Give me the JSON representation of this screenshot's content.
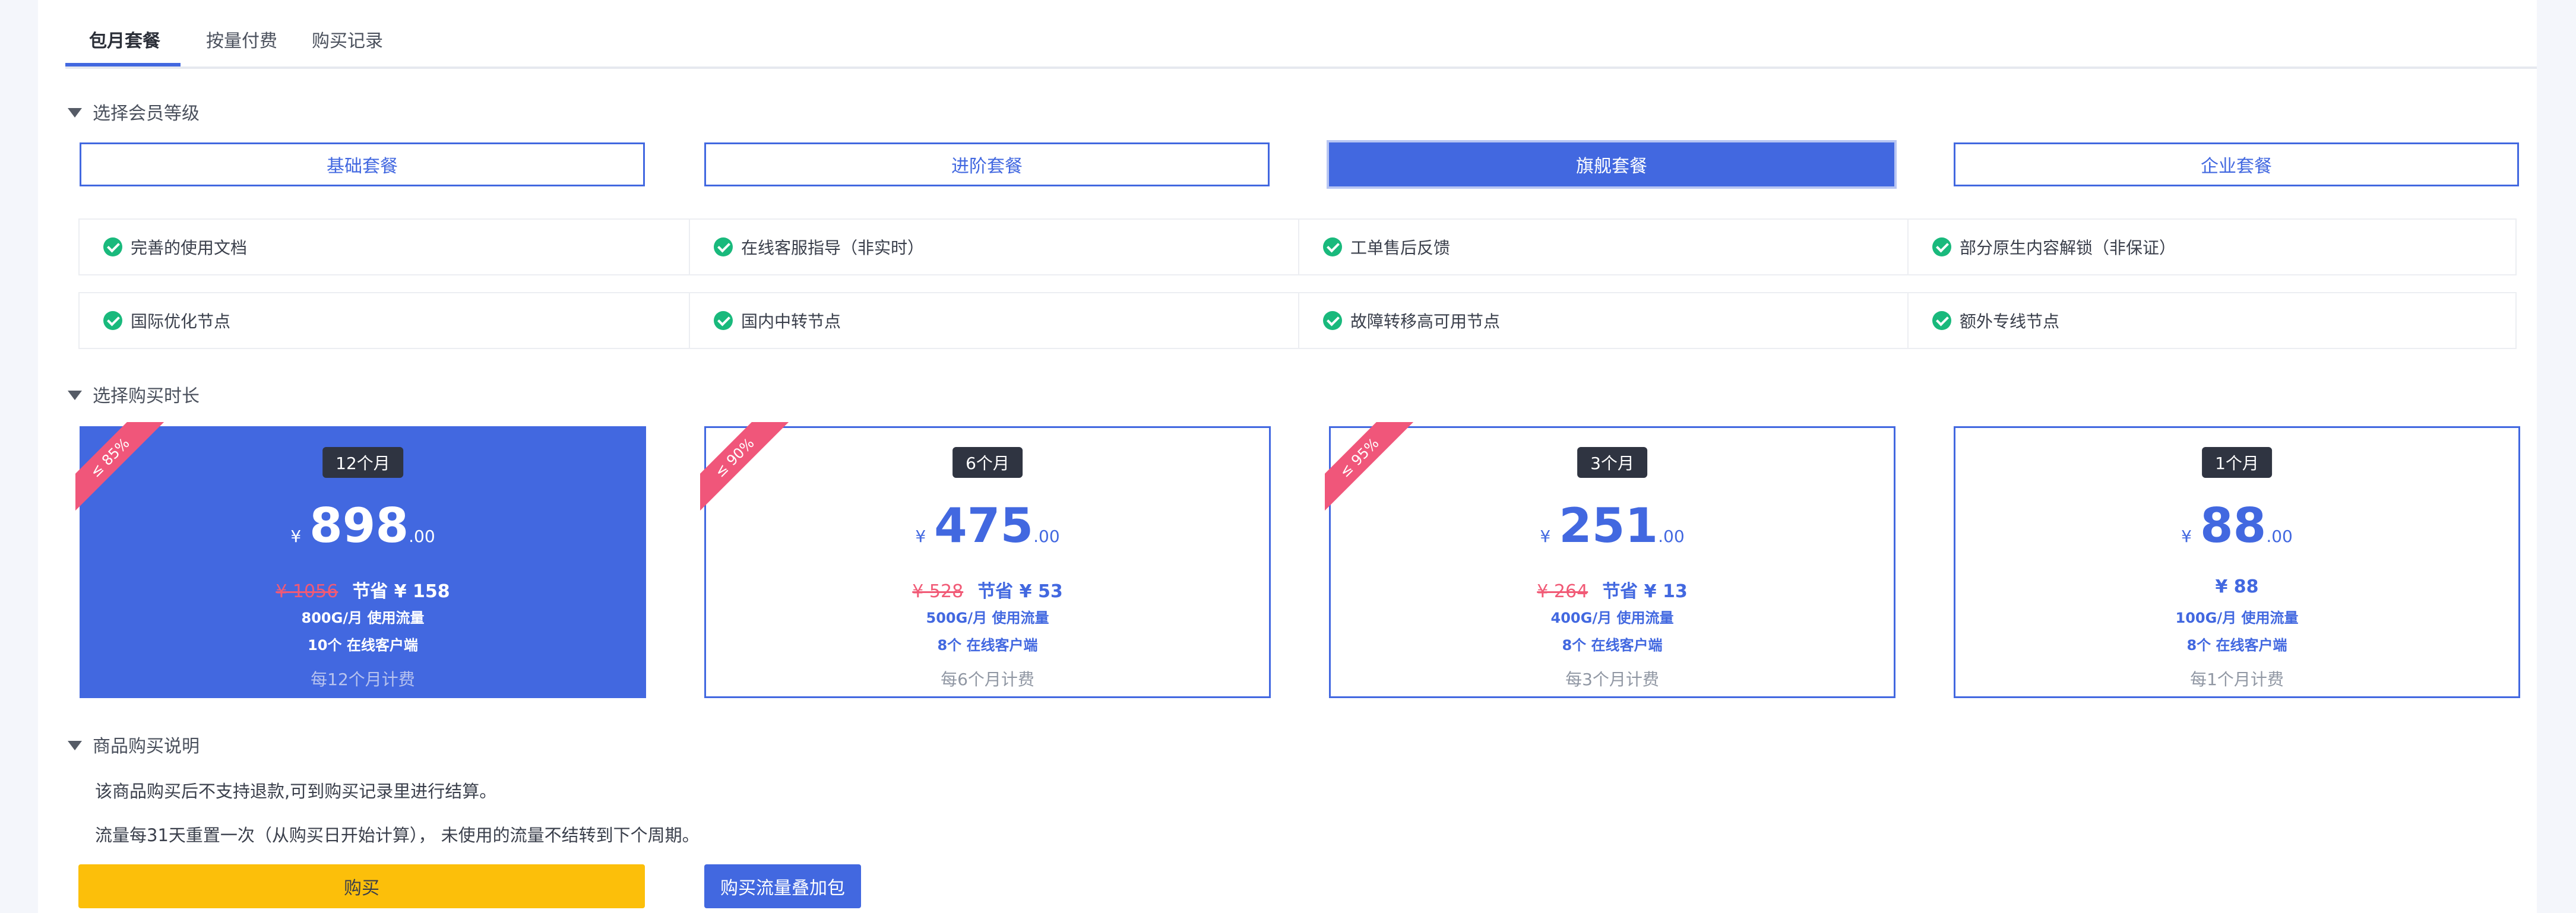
{
  "tabs": [
    {
      "label": "包月套餐",
      "active": true
    },
    {
      "label": "按量付费",
      "active": false
    },
    {
      "label": "购买记录",
      "active": false
    }
  ],
  "sections": {
    "level": "选择会员等级",
    "duration": "选择购买时长",
    "notes": "商品购买说明"
  },
  "tiers": [
    {
      "label": "基础套餐",
      "selected": false
    },
    {
      "label": "进阶套餐",
      "selected": false
    },
    {
      "label": "旗舰套餐",
      "selected": true
    },
    {
      "label": "企业套餐",
      "selected": false
    }
  ],
  "features": [
    [
      "完善的使用文档",
      "在线客服指导（非实时）",
      "工单售后反馈",
      "部分原生内容解锁（非保证）"
    ],
    [
      "国际优化节点",
      "国内中转节点",
      "故障转移高可用节点",
      "额外专线节点"
    ]
  ],
  "plans": [
    {
      "duration": "12个月",
      "discount": "≤ 85%",
      "currency": "¥",
      "price": "898",
      "cents": ".00",
      "old_price": "¥ 1056",
      "saving": "节省 ¥ 158",
      "traffic": "800G/月 使用流量",
      "clients": "10个 在线客户端",
      "billing": "每12个月计费",
      "selected": true
    },
    {
      "duration": "6个月",
      "discount": "≤ 90%",
      "currency": "¥",
      "price": "475",
      "cents": ".00",
      "old_price": "¥ 528",
      "saving": "节省 ¥ 53",
      "traffic": "500G/月 使用流量",
      "clients": "8个 在线客户端",
      "billing": "每6个月计费",
      "selected": false
    },
    {
      "duration": "3个月",
      "discount": "≤ 95%",
      "currency": "¥",
      "price": "251",
      "cents": ".00",
      "old_price": "¥ 264",
      "saving": "节省 ¥ 13",
      "traffic": "400G/月 使用流量",
      "clients": "8个 在线客户端",
      "billing": "每3个月计费",
      "selected": false
    },
    {
      "duration": "1个月",
      "discount": "",
      "currency": "¥",
      "price": "88",
      "cents": ".00",
      "old_price": "",
      "saving": "¥ 88",
      "traffic": "100G/月 使用流量",
      "clients": "8个 在线客户端",
      "billing": "每1个月计费",
      "selected": false
    }
  ],
  "notes": [
    "该商品购买后不支持退款,可到购买记录里进行结算。",
    "流量每31天重置一次（从购买日开始计算）， 未使用的流量不结转到下个周期。"
  ],
  "buttons": {
    "buy": "购买",
    "traffic_pack": "购买流量叠加包"
  },
  "colors": {
    "accent": "#4268e0",
    "buy": "#fcbf0a",
    "ribbon": "#f0567a",
    "check": "#19b97c"
  }
}
